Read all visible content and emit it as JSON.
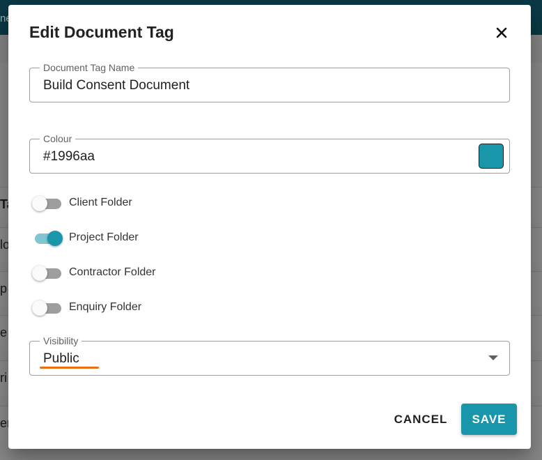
{
  "colors": {
    "accent": "#1996aa",
    "focus_underline": "#ee6c16",
    "topbar": "#0b3a46"
  },
  "background": {
    "topbar_text": "ne",
    "column_header": "Ta",
    "rows": [
      "lo",
      "p",
      "e",
      "ri",
      "er"
    ]
  },
  "dialog": {
    "title": "Edit Document Tag",
    "close_icon": "close-icon",
    "tag_name": {
      "label": "Document Tag Name",
      "value": "Build Consent Document"
    },
    "colour": {
      "label": "Colour",
      "value": "#1996aa"
    },
    "toggles": [
      {
        "label": "Client Folder",
        "on": false
      },
      {
        "label": "Project Folder",
        "on": true
      },
      {
        "label": "Contractor Folder",
        "on": false
      },
      {
        "label": "Enquiry Folder",
        "on": false
      }
    ],
    "visibility": {
      "label": "Visibility",
      "value": "Public",
      "icon": "dropdown-arrow-icon"
    },
    "actions": {
      "cancel_label": "CANCEL",
      "save_label": "SAVE"
    }
  }
}
